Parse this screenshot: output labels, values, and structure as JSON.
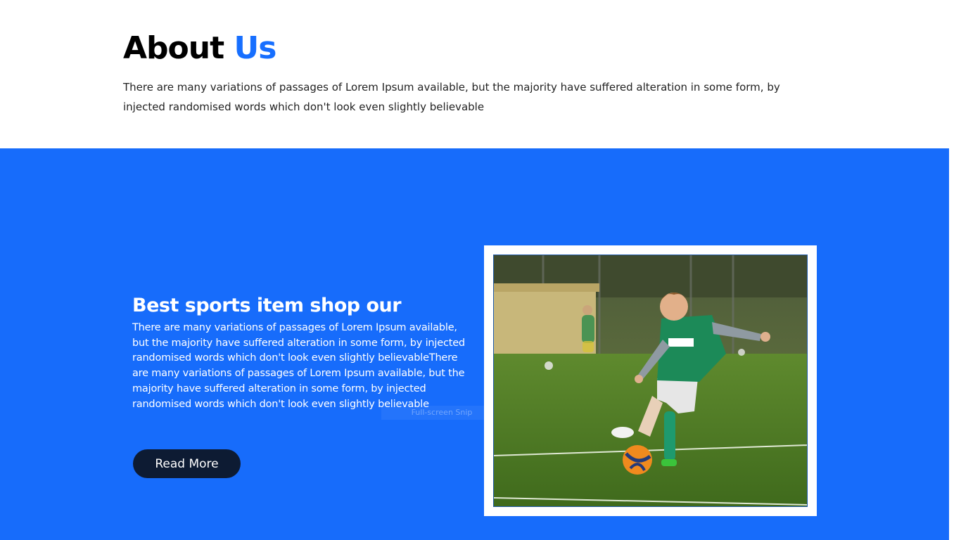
{
  "about": {
    "title_main": "About",
    "title_accent": "Us",
    "text": "There are many variations of passages of Lorem Ipsum available, but the majority have suffered alteration in some form, by injected randomised words which don't look even slightly believable"
  },
  "feature": {
    "title": "Best sports item shop our",
    "text": "There are many variations of passages of Lorem Ipsum available, but the majority have suffered alteration in some form, by injected randomised words which don't look even slightly believableThere are many variations of passages of Lorem Ipsum available, but the majority have suffered alteration in some form, by injected randomised words which don't look even slightly believable",
    "button_label": "Read More",
    "image_icon": "photo-boy-kicking-soccer-ball"
  },
  "overlay": {
    "label": "Full-screen Snip"
  },
  "scrollbar": {
    "up_icon": "▲",
    "down_icon": "▼"
  },
  "colors": {
    "accent": "#176fff",
    "section_bg": "#176cfb",
    "button_bg": "#0d1b33",
    "text_dark": "#222222"
  }
}
